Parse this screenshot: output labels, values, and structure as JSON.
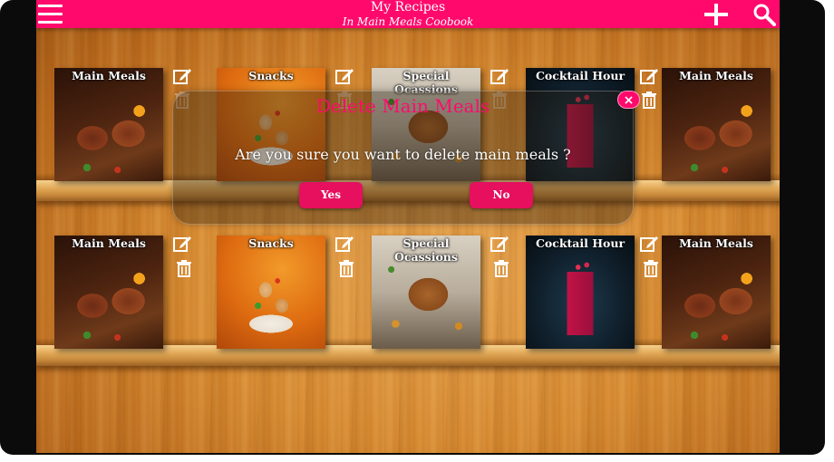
{
  "header": {
    "title": "My Recipes",
    "subtitle": "In Main Meals Coobook",
    "menu_icon": "hamburger-menu-icon",
    "add_icon": "plus-icon",
    "search_icon": "search-icon"
  },
  "colors": {
    "brand": "#ff0a6c",
    "button": "#e6105f",
    "wood": "#d6892f"
  },
  "shelves": [
    {
      "books": [
        {
          "title": "Main Meals",
          "image": "grilled-steak",
          "actions": [
            "edit-icon",
            "trash-icon"
          ]
        },
        {
          "title": "Snacks",
          "image": "chicken-skewer",
          "actions": [
            "edit-icon",
            "trash-icon"
          ]
        },
        {
          "title": "Special Ocassions",
          "image": "roast-turkey",
          "actions": [
            "edit-icon",
            "trash-icon"
          ]
        },
        {
          "title": "Cocktail Hour",
          "image": "red-cocktail",
          "actions": [
            "edit-icon",
            "trash-icon"
          ]
        },
        {
          "title": "Main Meals",
          "image": "grilled-steak",
          "actions": []
        }
      ]
    },
    {
      "books": [
        {
          "title": "Main Meals",
          "image": "grilled-steak",
          "actions": [
            "edit-icon",
            "trash-icon"
          ]
        },
        {
          "title": "Snacks",
          "image": "chicken-skewer",
          "actions": [
            "edit-icon",
            "trash-icon"
          ]
        },
        {
          "title": "Special Ocassions",
          "image": "roast-turkey",
          "actions": [
            "edit-icon",
            "trash-icon"
          ]
        },
        {
          "title": "Cocktail Hour",
          "image": "red-cocktail",
          "actions": [
            "edit-icon",
            "trash-icon"
          ]
        },
        {
          "title": "Main Meals",
          "image": "grilled-steak",
          "actions": []
        }
      ]
    }
  ],
  "dialog": {
    "title": "Delete Main Meals",
    "message": "Are you sure you want to delete main meals ?",
    "yes_label": "Yes",
    "no_label": "No",
    "close_label": "×"
  }
}
